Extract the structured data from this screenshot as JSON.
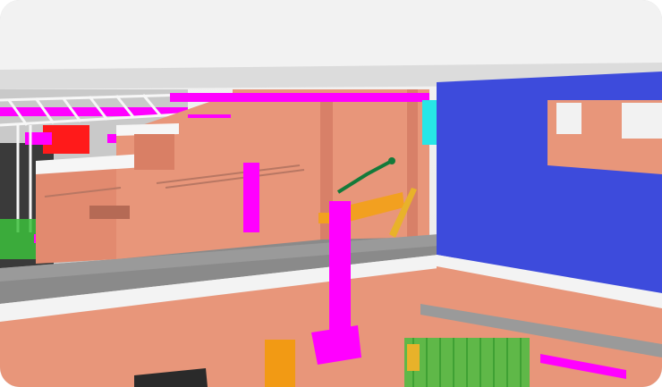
{
  "viewer": {
    "view_type": "3D BIM model viewport",
    "icons": [
      "scene-view-icon"
    ]
  },
  "colors": {
    "sky": "#ebebeb",
    "ceiling": "#d8d8d8",
    "wall_salmon": "#e8967a",
    "wall_blue": "#3d4bdc",
    "floor_gray": "#8c8c8c",
    "pipe_magenta": "#ff00ff",
    "duct_red": "#ff1a1a",
    "truss_white": "#f7f7f7",
    "cyan_panel": "#27e6e6",
    "mesh_green": "#2ebd2e",
    "beam_orange": "#f2a020",
    "pipe_dark_green": "#147a3a"
  }
}
